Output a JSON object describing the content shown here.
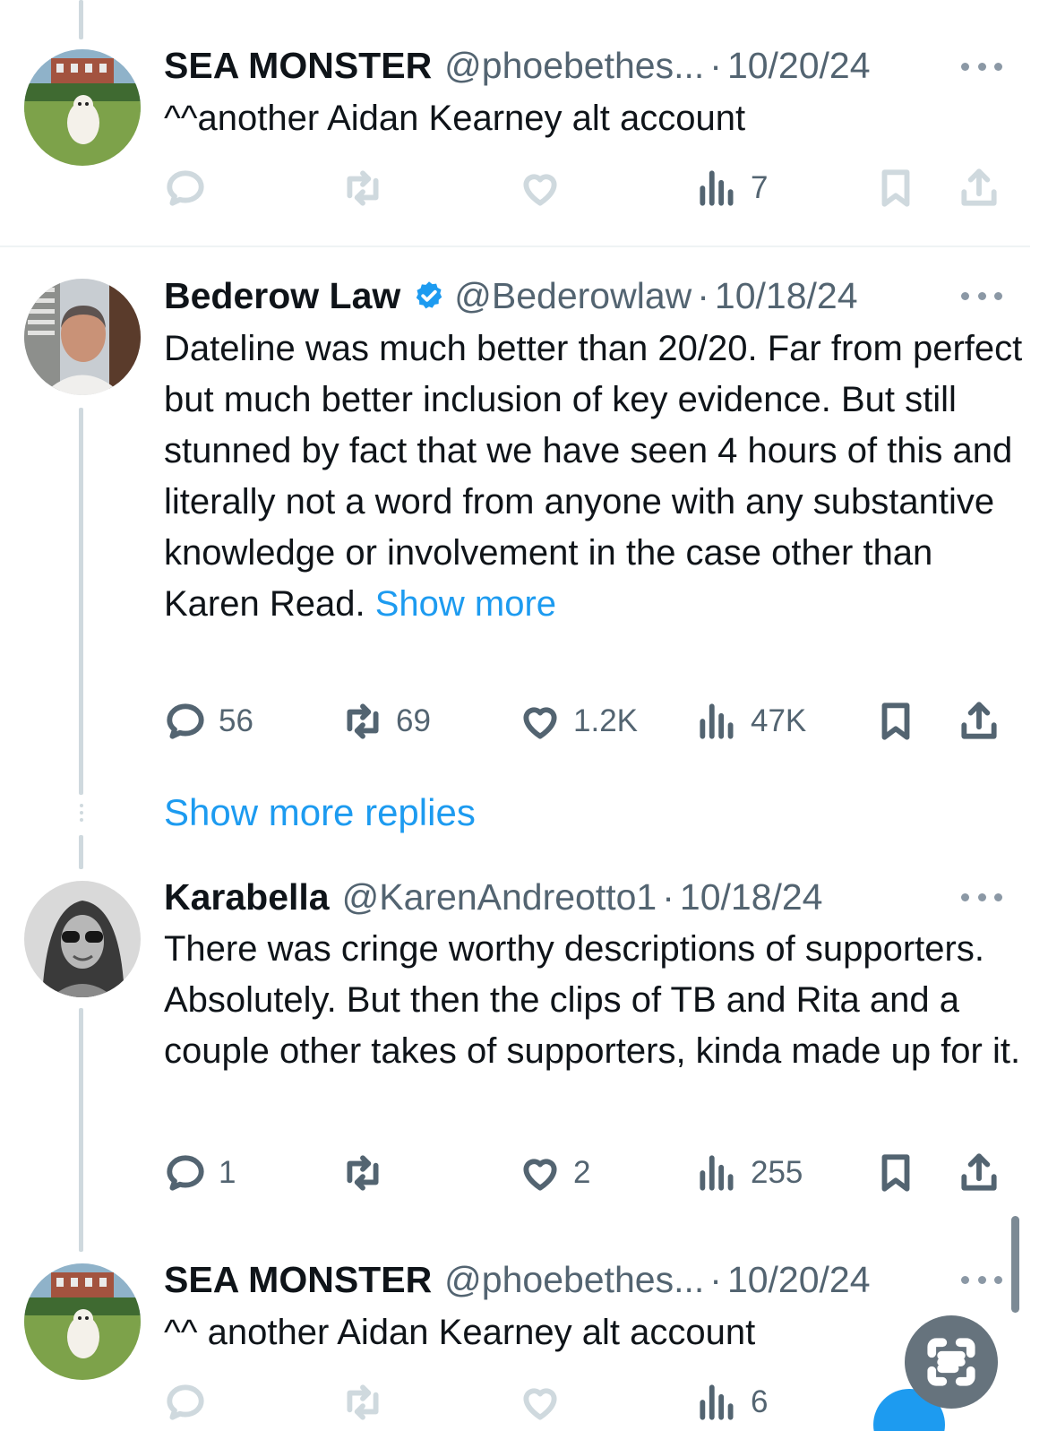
{
  "tweets": [
    {
      "name": "SEA MONSTER",
      "handle": "@phoebethes...",
      "date": "10/20/24",
      "text": "^^another Aidan Kearney alt account",
      "views": "7"
    },
    {
      "name": "Bederow Law",
      "verified": true,
      "handle": "@Bederowlaw",
      "date": "10/18/24",
      "text": "Dateline was much better than 20/20.  Far from perfect but much better inclusion of key evidence.  But still stunned by fact that we have seen 4 hours of this and literally not a word from anyone with any substantive knowledge or involvement in the case other than Karen Read.",
      "show_more": "Show more",
      "replies": "56",
      "reposts": "69",
      "likes": "1.2K",
      "views": "47K"
    },
    {
      "name": "Karabella",
      "handle": "@KarenAndreotto1",
      "date": "10/18/24",
      "text": "There was cringe worthy descriptions of supporters.  Absolutely.  But then the clips of TB and Rita and a couple other takes of supporters, kinda made up for it.",
      "replies": "1",
      "likes": "2",
      "views": "255"
    },
    {
      "name": "SEA MONSTER",
      "handle": "@phoebethes...",
      "date": "10/20/24",
      "text": "^^ another Aidan Kearney alt account",
      "views": "6"
    }
  ],
  "show_more_replies": "Show more replies",
  "dot_separator": "·",
  "colors": {
    "link": "#1d9bf0",
    "secondary": "#536471",
    "thread": "#cfd9de"
  },
  "icons": [
    "reply-icon",
    "repost-icon",
    "like-icon",
    "views-icon",
    "bookmark-icon",
    "share-icon",
    "more-icon",
    "verified-badge-icon",
    "text-scan-icon"
  ]
}
